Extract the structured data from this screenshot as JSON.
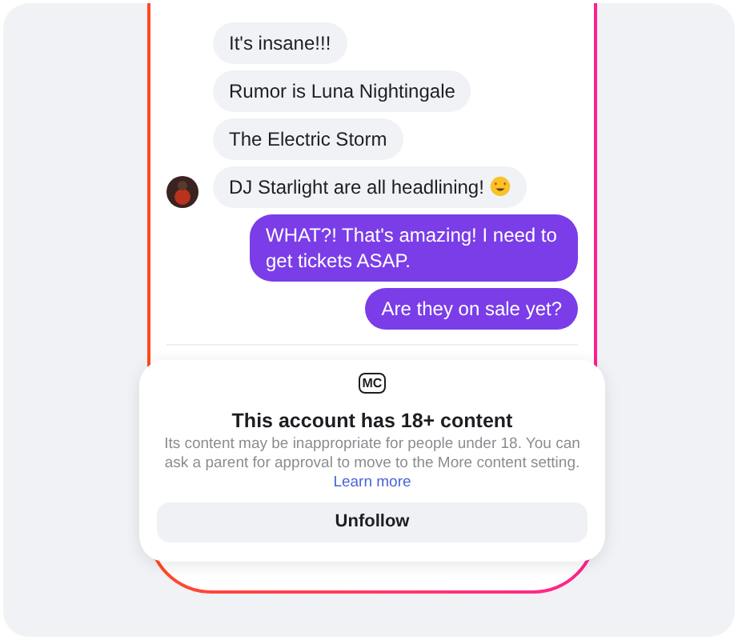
{
  "messages": [
    {
      "text": "It's insane!!!",
      "kind": "incoming",
      "avatar": false,
      "emoji": false
    },
    {
      "text": "Rumor is Luna Nightingale",
      "kind": "incoming",
      "avatar": false,
      "emoji": false
    },
    {
      "text": "The Electric Storm",
      "kind": "incoming",
      "avatar": false,
      "emoji": false
    },
    {
      "text": "DJ Starlight are all headlining!",
      "kind": "incoming",
      "avatar": true,
      "emoji": true
    },
    {
      "text": "WHAT?! That's amazing! I need to get tickets ASAP.",
      "kind": "outgoing"
    },
    {
      "text": "Are they on sale yet?",
      "kind": "outgoing"
    }
  ],
  "notice": {
    "icon_label": "MC",
    "title": "This account has 18+ content",
    "body": "Its content may be inappropriate for people under 18. You can ask a parent for approval to move to the More content setting.",
    "link": "Learn more",
    "button": "Unfollow"
  }
}
